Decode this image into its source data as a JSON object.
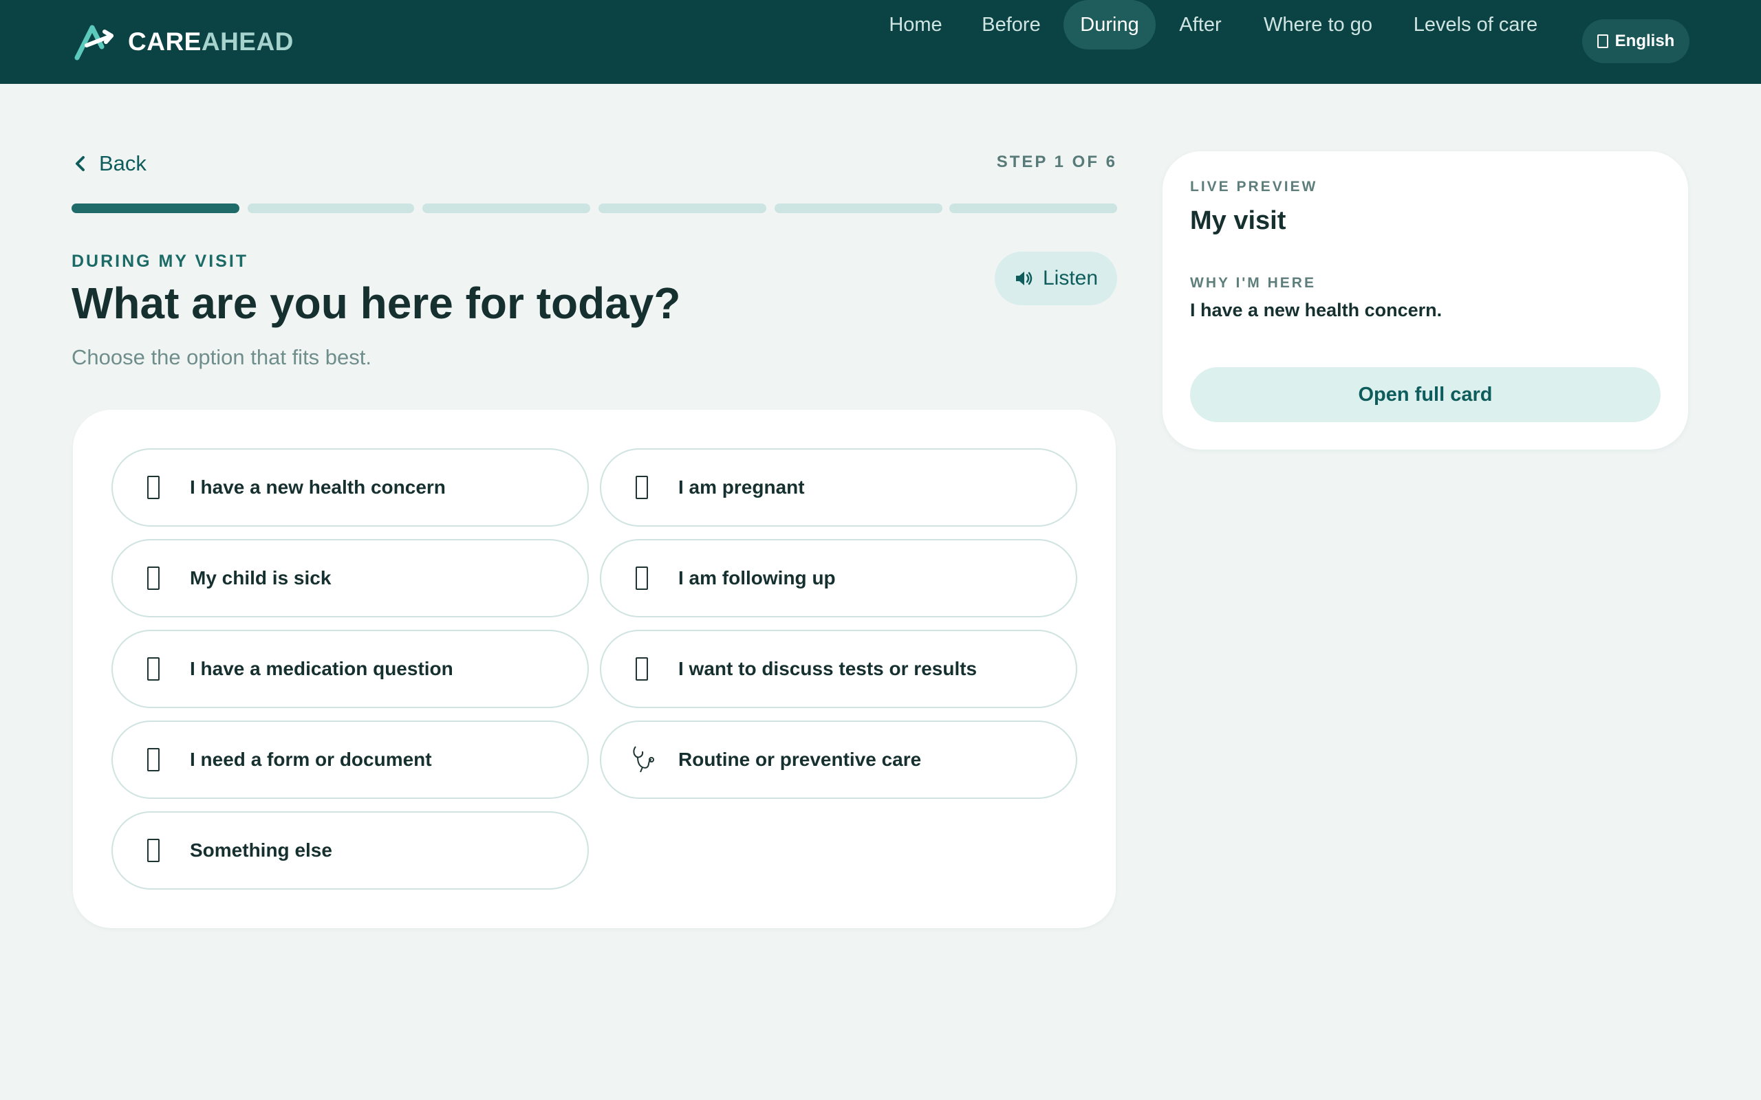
{
  "brand": {
    "part1": "CARE",
    "part2": "AHEAD"
  },
  "nav": [
    {
      "label": "Home",
      "active": false
    },
    {
      "label": "Before",
      "active": false
    },
    {
      "label": "During",
      "active": true
    },
    {
      "label": "After",
      "active": false
    },
    {
      "label": "Where to go",
      "active": false
    },
    {
      "label": "Levels of care",
      "active": false
    }
  ],
  "language": {
    "label": "English",
    "icon": "globe-icon"
  },
  "back": {
    "label": "Back",
    "icon": "chevron-left-icon"
  },
  "step": {
    "text": "STEP 1 OF 6",
    "current": 1,
    "total": 6
  },
  "header": {
    "eyebrow": "DURING MY VISIT",
    "title": "What are you here for today?",
    "subtitle": "Choose the option that fits best."
  },
  "listen": {
    "label": "Listen",
    "icon": "speaker-icon"
  },
  "options": [
    {
      "label": "I have a new health concern",
      "icon": "placeholder-icon"
    },
    {
      "label": "I am pregnant",
      "icon": "placeholder-icon"
    },
    {
      "label": "My child is sick",
      "icon": "placeholder-icon"
    },
    {
      "label": "I am following up",
      "icon": "placeholder-icon"
    },
    {
      "label": "I have a medication question",
      "icon": "placeholder-icon"
    },
    {
      "label": "I want to discuss tests or results",
      "icon": "placeholder-icon"
    },
    {
      "label": "I need a form or document",
      "icon": "placeholder-icon"
    },
    {
      "label": "Routine or preventive care",
      "icon": "stethoscope-icon"
    },
    {
      "label": "Something else",
      "icon": "placeholder-icon"
    }
  ],
  "preview": {
    "eyebrow": "LIVE PREVIEW",
    "title": "My visit",
    "why_label": "WHY I'M HERE",
    "why_value": "I have a new health concern.",
    "button": "Open full card"
  },
  "colors": {
    "header_bg": "#0b4244",
    "page_bg": "#f0f5f4",
    "accent": "#1f6b69",
    "accent_light": "#dcf0ee"
  }
}
